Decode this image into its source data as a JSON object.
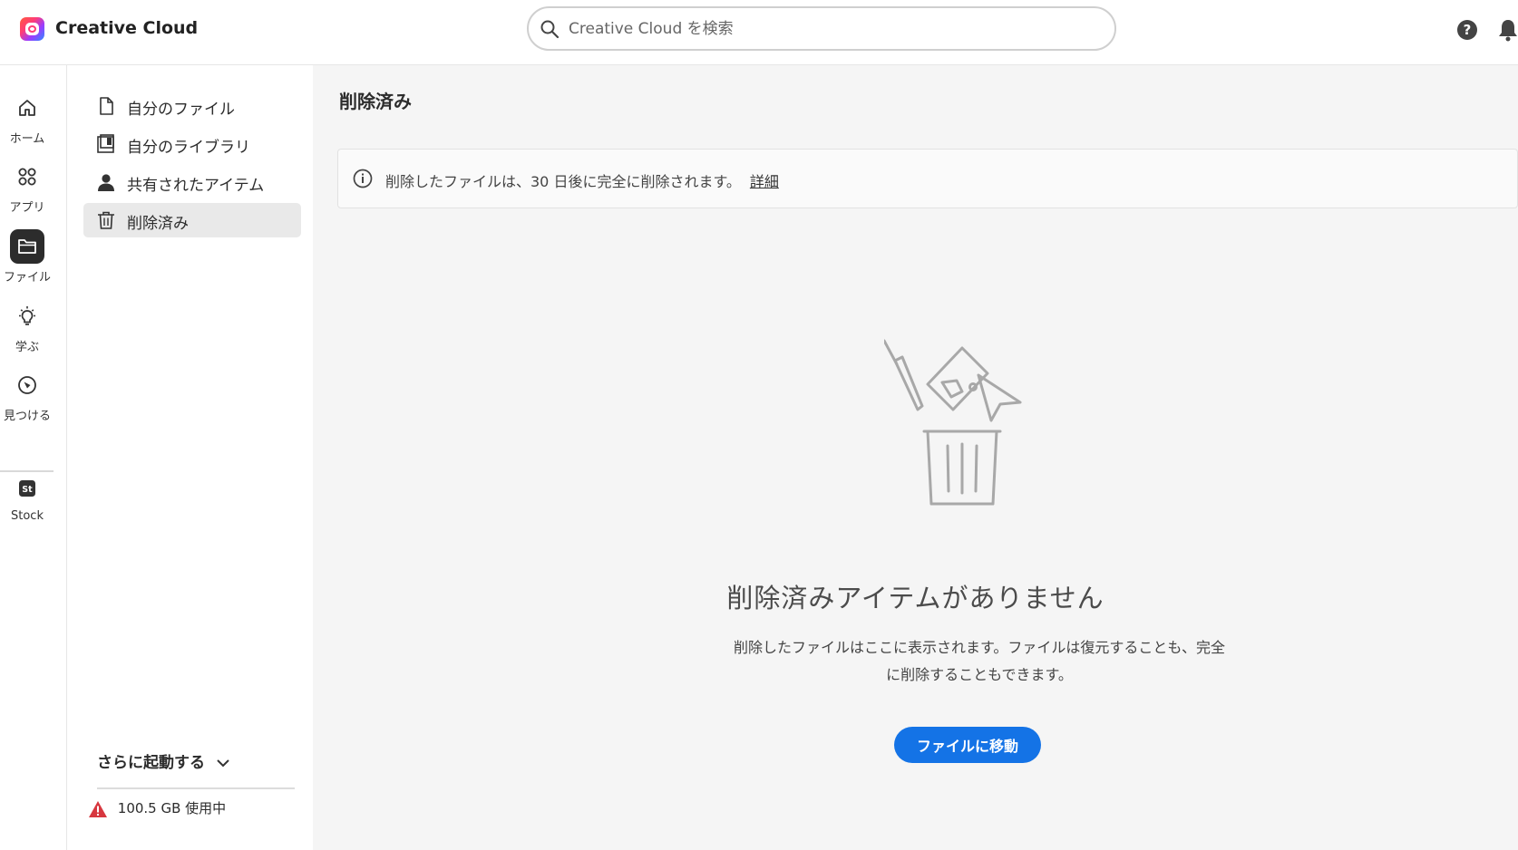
{
  "header": {
    "app_title": "Creative Cloud",
    "search_placeholder": "Creative Cloud を検索"
  },
  "rail": {
    "items": [
      {
        "label": "ホーム",
        "icon": "home-icon"
      },
      {
        "label": "アプリ",
        "icon": "apps-grid-icon"
      },
      {
        "label": "ファイル",
        "icon": "folder-icon",
        "active": true
      },
      {
        "label": "学ぶ",
        "icon": "lightbulb-icon"
      },
      {
        "label": "見つける",
        "icon": "compass-icon"
      },
      {
        "label": "Stock",
        "icon": "stock-icon"
      }
    ],
    "stock_glyph": "St"
  },
  "subnav": {
    "items": [
      {
        "label": "自分のファイル",
        "icon": "document-icon"
      },
      {
        "label": "自分のライブラリ",
        "icon": "library-icon"
      },
      {
        "label": "共有されたアイテム",
        "icon": "user-icon"
      },
      {
        "label": "削除済み",
        "icon": "trash-icon",
        "active": true
      }
    ],
    "launch_more": "さらに起動する",
    "storage": "100.5 GB 使用中"
  },
  "main": {
    "title": "削除済み",
    "notice": {
      "message": "削除したファイルは、30 日後に完全に削除されます。",
      "link": "詳細"
    },
    "empty": {
      "title": "削除済みアイテムがありません",
      "description_line1": "削除したファイルはここに表示されます。ファイルは復元することも、完全",
      "description_line2": "に削除することもできます。",
      "button": "ファイルに移動"
    }
  },
  "colors": {
    "accent": "#1473e6",
    "warning": "#d7373f",
    "active_rail": "#2c2c2c"
  }
}
